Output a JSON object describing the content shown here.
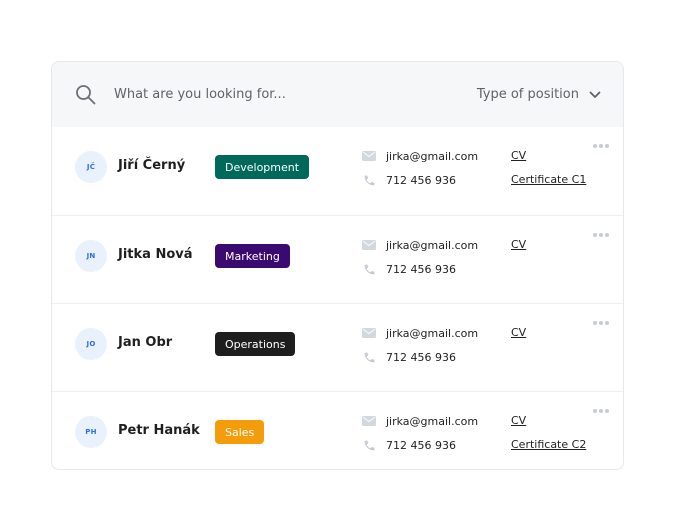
{
  "search": {
    "placeholder": "What are you looking for...",
    "value": "",
    "filter_label": "Type of position",
    "icon": "search-icon",
    "filter_icon": "chevron-down-icon"
  },
  "colors": {
    "development": "#00695c",
    "marketing": "#3a0a70",
    "operations": "#1e1e1e",
    "sales": "#f59c0b",
    "avatar_bg": "#e9f1fd",
    "avatar_text": "#2f6ee0"
  },
  "candidates": [
    {
      "initials": "JČ",
      "name": "Jiří Černý",
      "position": "Development",
      "position_key": "development",
      "email": "jirka@gmail.com",
      "phone": "712 456 936",
      "documents": [
        "CV",
        "Certificate C1"
      ]
    },
    {
      "initials": "JN",
      "name": "Jitka Nová",
      "position": "Marketing",
      "position_key": "marketing",
      "email": "jirka@gmail.com",
      "phone": "712 456 936",
      "documents": [
        "CV"
      ]
    },
    {
      "initials": "JO",
      "name": "Jan Obr",
      "position": "Operations",
      "position_key": "operations",
      "email": "jirka@gmail.com",
      "phone": "712 456 936",
      "documents": [
        "CV"
      ]
    },
    {
      "initials": "PH",
      "name": "Petr Hanák",
      "position": "Sales",
      "position_key": "sales",
      "email": "jirka@gmail.com",
      "phone": "712 456 936",
      "documents": [
        "CV",
        "Certificate C2"
      ]
    }
  ]
}
